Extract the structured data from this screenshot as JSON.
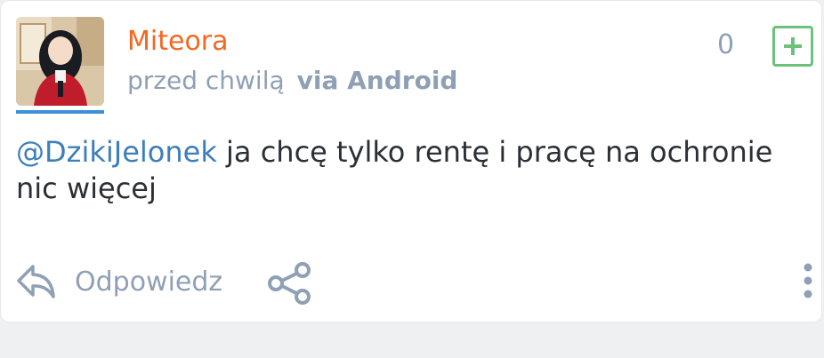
{
  "post": {
    "username": "Miteora",
    "time": "przed chwilą",
    "via": "via Android",
    "vote_count": "0",
    "mention": "@DzikiJelonek",
    "message": " ja chcę tylko rentę i pracę na ochronie nic więcej"
  },
  "actions": {
    "reply_label": "Odpowiedz"
  },
  "colors": {
    "username": "#f26722",
    "meta": "#8fa0b5",
    "mention": "#3d7fb8",
    "plus": "#6cc27a",
    "avatar_underline": "#3d8fd8"
  },
  "icons": {
    "plus": "plus-square-icon",
    "reply": "reply-icon",
    "share": "share-icon",
    "more": "more-vertical-icon"
  }
}
